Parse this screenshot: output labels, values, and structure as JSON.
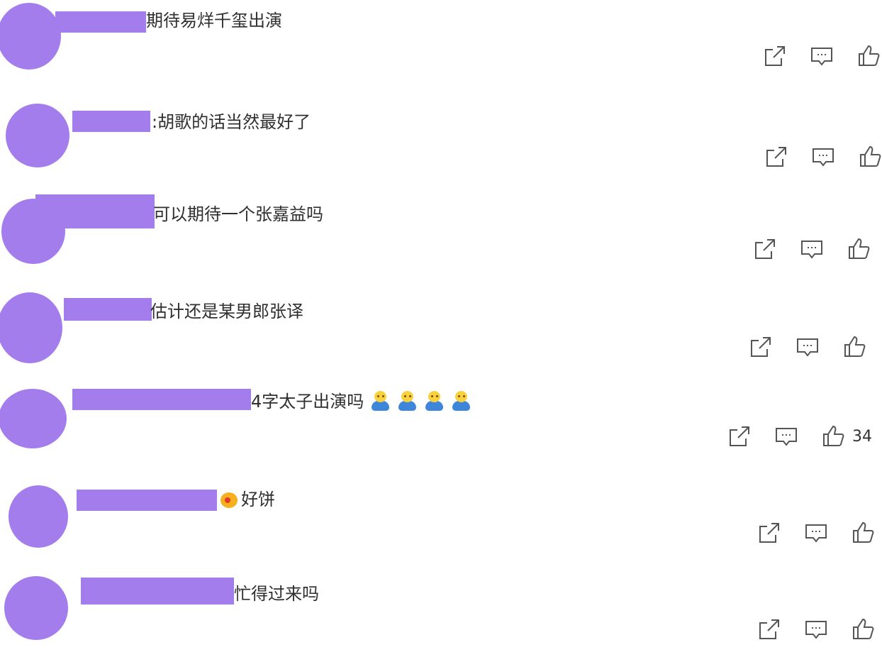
{
  "colors": {
    "avatar": "#a47ded",
    "icon": "#555555",
    "text": "#2f2f2f"
  },
  "icons": {
    "share": "share-icon",
    "reply": "comment-icon",
    "like": "thumbs-up-icon"
  },
  "comments": [
    {
      "text": "期待易烊千玺出演",
      "likes": ""
    },
    {
      "text": ":胡歌的话当然最好了",
      "likes": ""
    },
    {
      "text": "可以期待一个张嘉益吗",
      "likes": ""
    },
    {
      "text": "估计还是某男郎张译",
      "likes": ""
    },
    {
      "text": "4字太子出演吗",
      "likes": "34"
    },
    {
      "text": "好饼",
      "likes": ""
    },
    {
      "text": "忙得过来吗",
      "likes": ""
    }
  ]
}
